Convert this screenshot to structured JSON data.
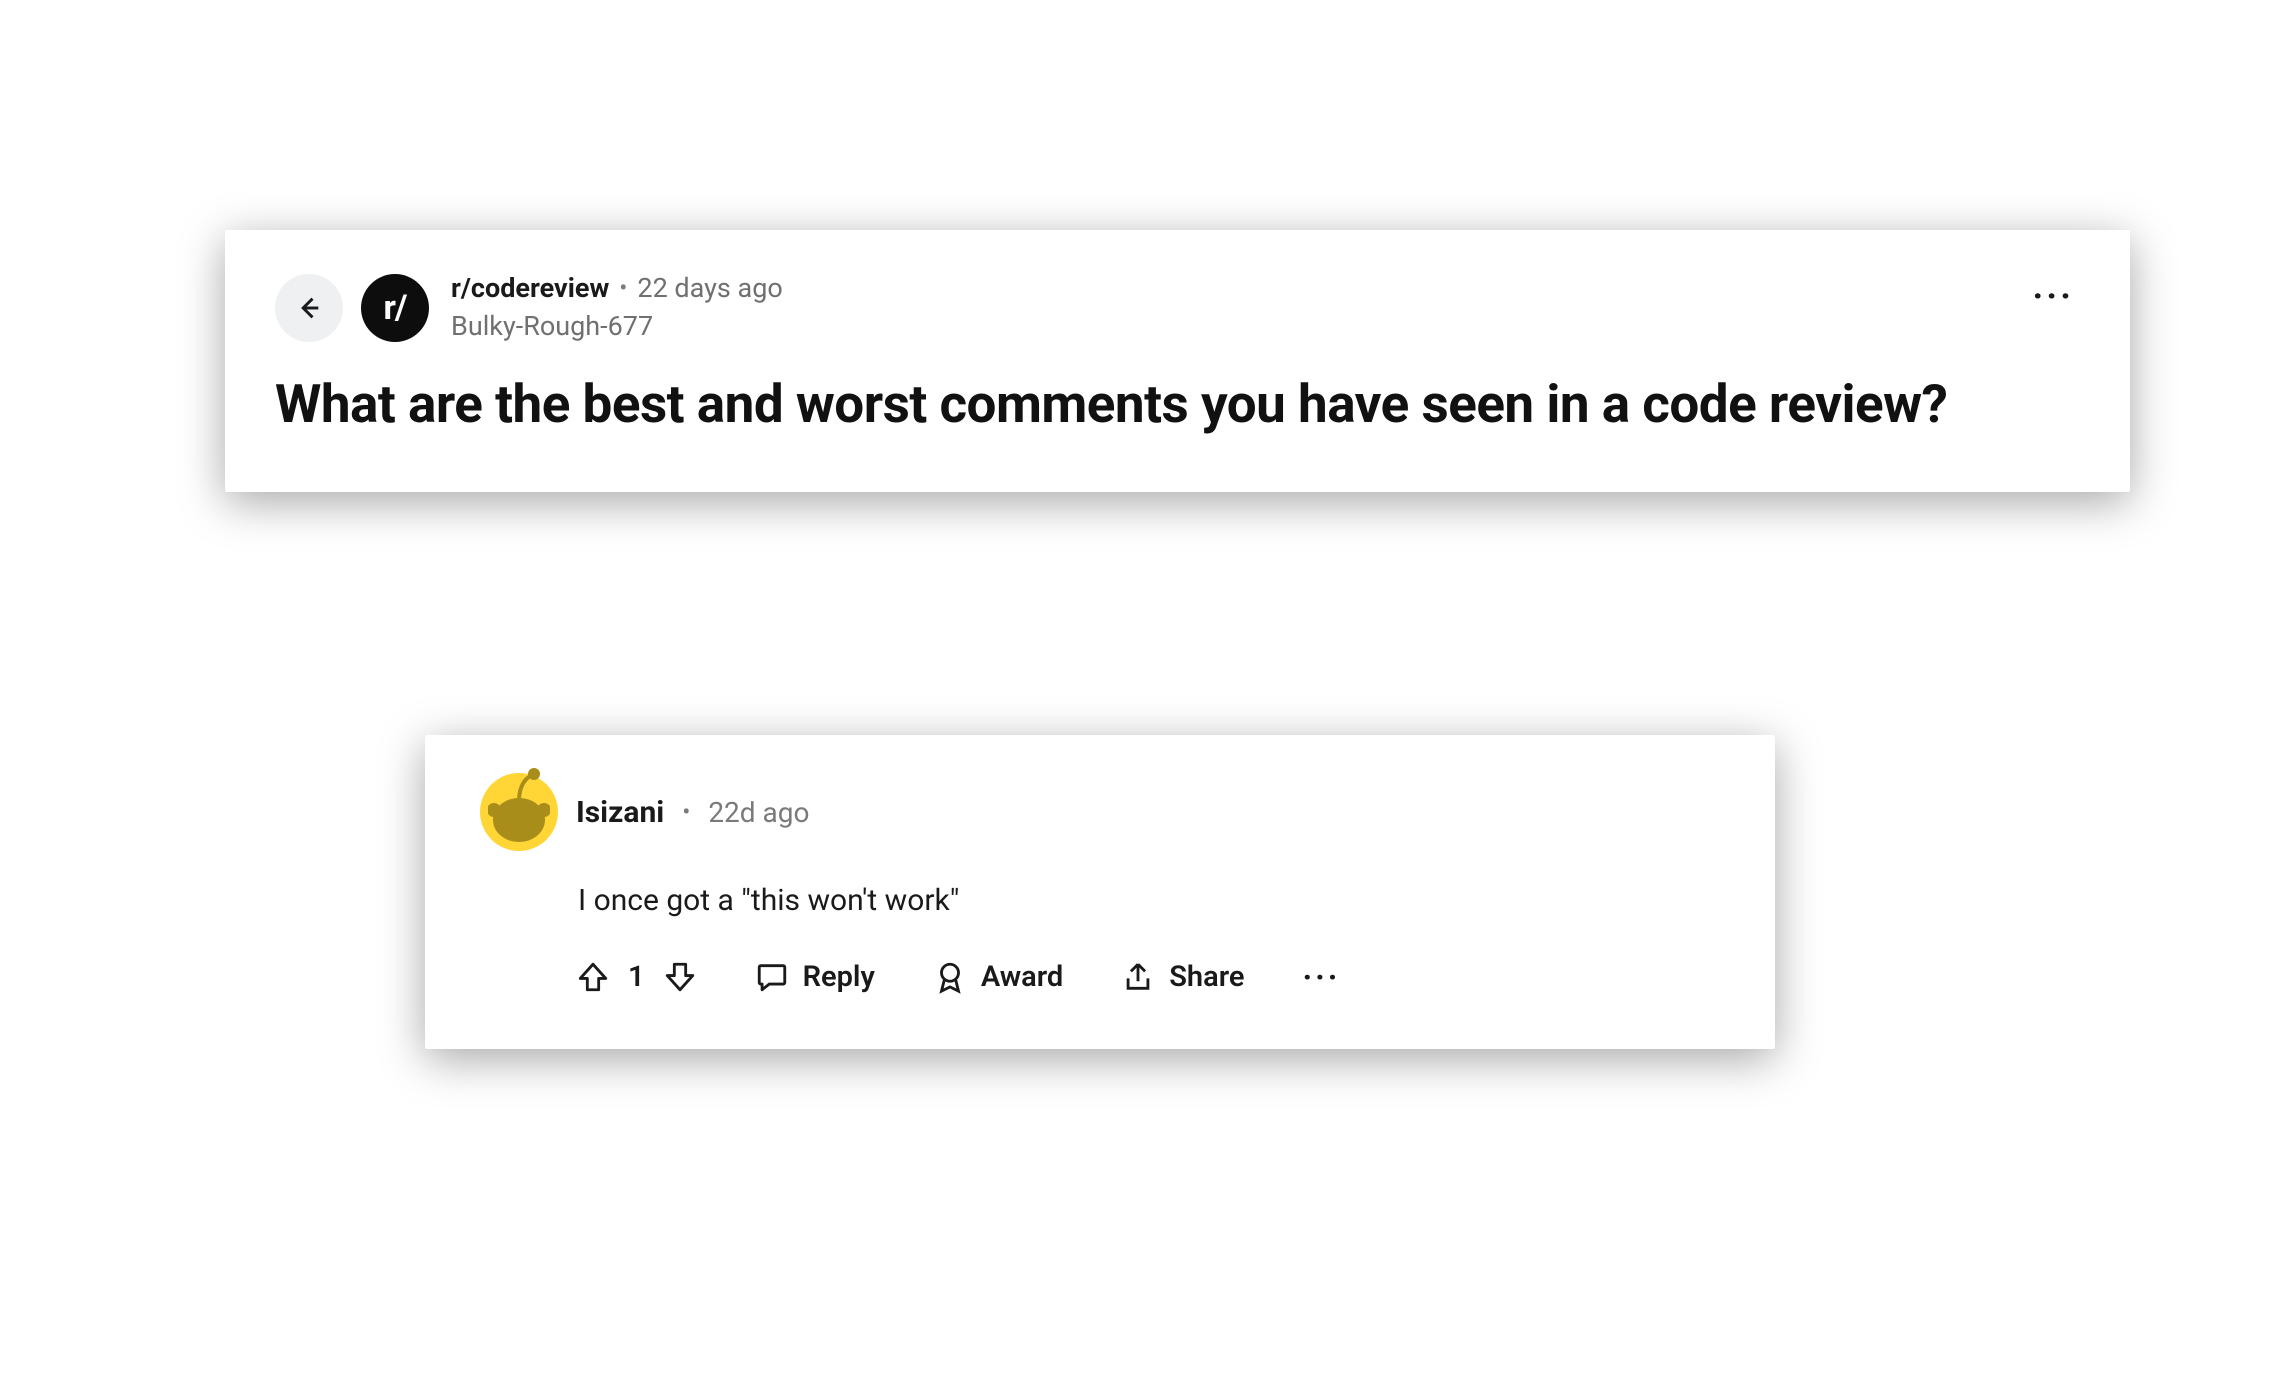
{
  "post": {
    "subreddit": "r/codereview",
    "subAvatarText": "r/",
    "age": "22 days ago",
    "author": "Bulky-Rough-677",
    "title": "What are the best and worst comments you have seen in a code review?"
  },
  "comment": {
    "user": "Isizani",
    "age": "22d ago",
    "body": "I once got a \"this won't work\"",
    "score": "1",
    "actions": {
      "reply": "Reply",
      "award": "Award",
      "share": "Share"
    }
  }
}
